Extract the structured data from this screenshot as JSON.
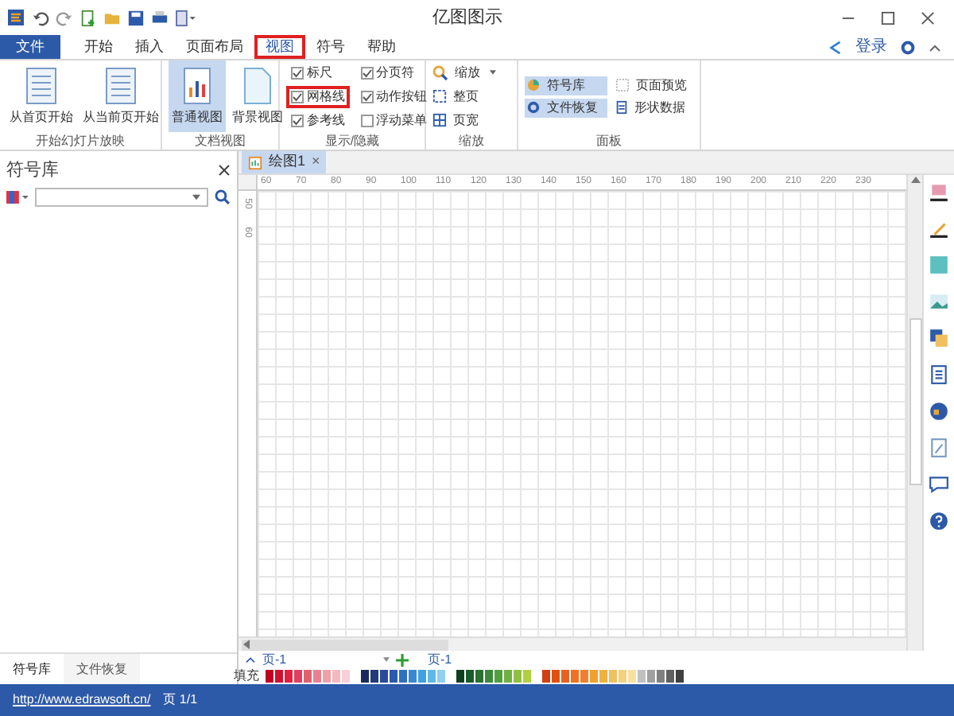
{
  "window": {
    "title": "亿图图示"
  },
  "account": {
    "login": "登录"
  },
  "tabs": [
    {
      "label": "文件",
      "kind": "file",
      "selected": false,
      "highlighted": false
    },
    {
      "label": "开始",
      "kind": "tab",
      "selected": false,
      "highlighted": false
    },
    {
      "label": "插入",
      "kind": "tab",
      "selected": false,
      "highlighted": false
    },
    {
      "label": "页面布局",
      "kind": "tab",
      "selected": false,
      "highlighted": false
    },
    {
      "label": "视图",
      "kind": "tab",
      "selected": true,
      "highlighted": true
    },
    {
      "label": "符号",
      "kind": "tab",
      "selected": false,
      "highlighted": false
    },
    {
      "label": "帮助",
      "kind": "tab",
      "selected": false,
      "highlighted": false
    }
  ],
  "ribbon": {
    "groups": [
      {
        "title": "开始幻灯片放映",
        "kind": "large",
        "items": [
          {
            "label": "从首页开始",
            "selected": false
          },
          {
            "label": "从当前页开始",
            "selected": false
          }
        ]
      },
      {
        "title": "文档视图",
        "kind": "large",
        "items": [
          {
            "label": "普通视图",
            "selected": true
          },
          {
            "label": "背景视图",
            "selected": false
          }
        ]
      },
      {
        "title": "显示/隐藏",
        "kind": "checks",
        "items": [
          {
            "label": "标尺",
            "checked": true,
            "highlighted": false
          },
          {
            "label": "分页符",
            "checked": true,
            "highlighted": false
          },
          {
            "label": "网格线",
            "checked": true,
            "highlighted": true
          },
          {
            "label": "动作按钮",
            "checked": true,
            "highlighted": false
          },
          {
            "label": "参考线",
            "checked": true,
            "highlighted": false
          },
          {
            "label": "浮动菜单",
            "checked": false,
            "highlighted": false
          }
        ]
      },
      {
        "title": "缩放",
        "kind": "small",
        "items": [
          {
            "label": "缩放",
            "selected": false
          },
          {
            "label": "整页",
            "selected": false
          },
          {
            "label": "页宽",
            "selected": false
          }
        ]
      },
      {
        "title": "面板",
        "kind": "panel",
        "items": [
          {
            "label": "符号库",
            "selected": true
          },
          {
            "label": "页面预览",
            "selected": false
          },
          {
            "label": "文件恢复",
            "selected": true
          },
          {
            "label": "形状数据",
            "selected": false
          }
        ]
      }
    ]
  },
  "library_panel": {
    "title": "符号库",
    "bottom_tabs": [
      {
        "label": "符号库",
        "selected": true
      },
      {
        "label": "文件恢复",
        "selected": false
      }
    ]
  },
  "document_tab": {
    "label": "绘图1",
    "close": "×"
  },
  "ruler": {
    "horizontal": [
      "60",
      "70",
      "80",
      "90",
      "100",
      "110",
      "120",
      "130",
      "140",
      "150",
      "160",
      "170",
      "180",
      "190",
      "200",
      "210",
      "220",
      "230"
    ],
    "vertical": [
      "50",
      "60"
    ]
  },
  "page_bar": {
    "page_select": "页-1",
    "page_tab": "页-1"
  },
  "fill_label": "填充",
  "status_bar": {
    "link": "http://www.edrawsoft.cn/",
    "page": "页 1/1"
  }
}
